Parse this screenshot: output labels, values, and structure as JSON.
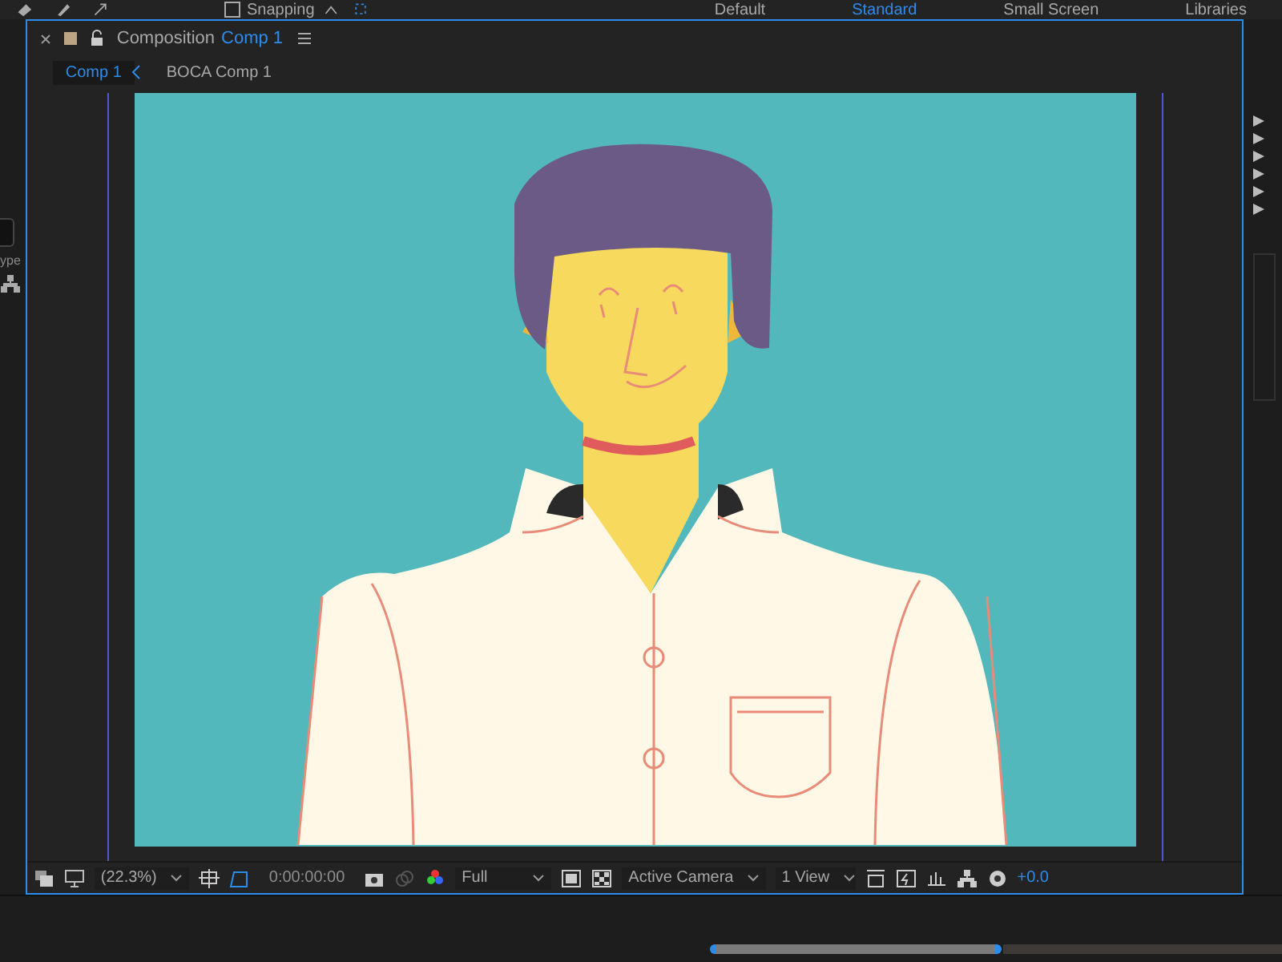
{
  "workspace_bar": {
    "snapping": "Snapping",
    "snapping_checked": false,
    "workspaces": [
      {
        "label": "Default",
        "selected": false
      },
      {
        "label": "Standard",
        "selected": true
      },
      {
        "label": "Small Screen",
        "selected": false
      },
      {
        "label": "Libraries",
        "selected": false
      }
    ]
  },
  "panel": {
    "title": "Composition",
    "comp_name": "Comp 1"
  },
  "breadcrumbs": [
    {
      "label": "Comp 1",
      "selected": true
    },
    {
      "label": "BOCA Comp 1",
      "selected": false
    }
  ],
  "left_panel": {
    "text": "ype"
  },
  "viewer_toolbar": {
    "magnification": "(22.3%)",
    "timecode": "0:00:00:00",
    "resolution": "Full",
    "camera": "Active Camera",
    "views": "1 View",
    "exposure": "+0.0"
  }
}
